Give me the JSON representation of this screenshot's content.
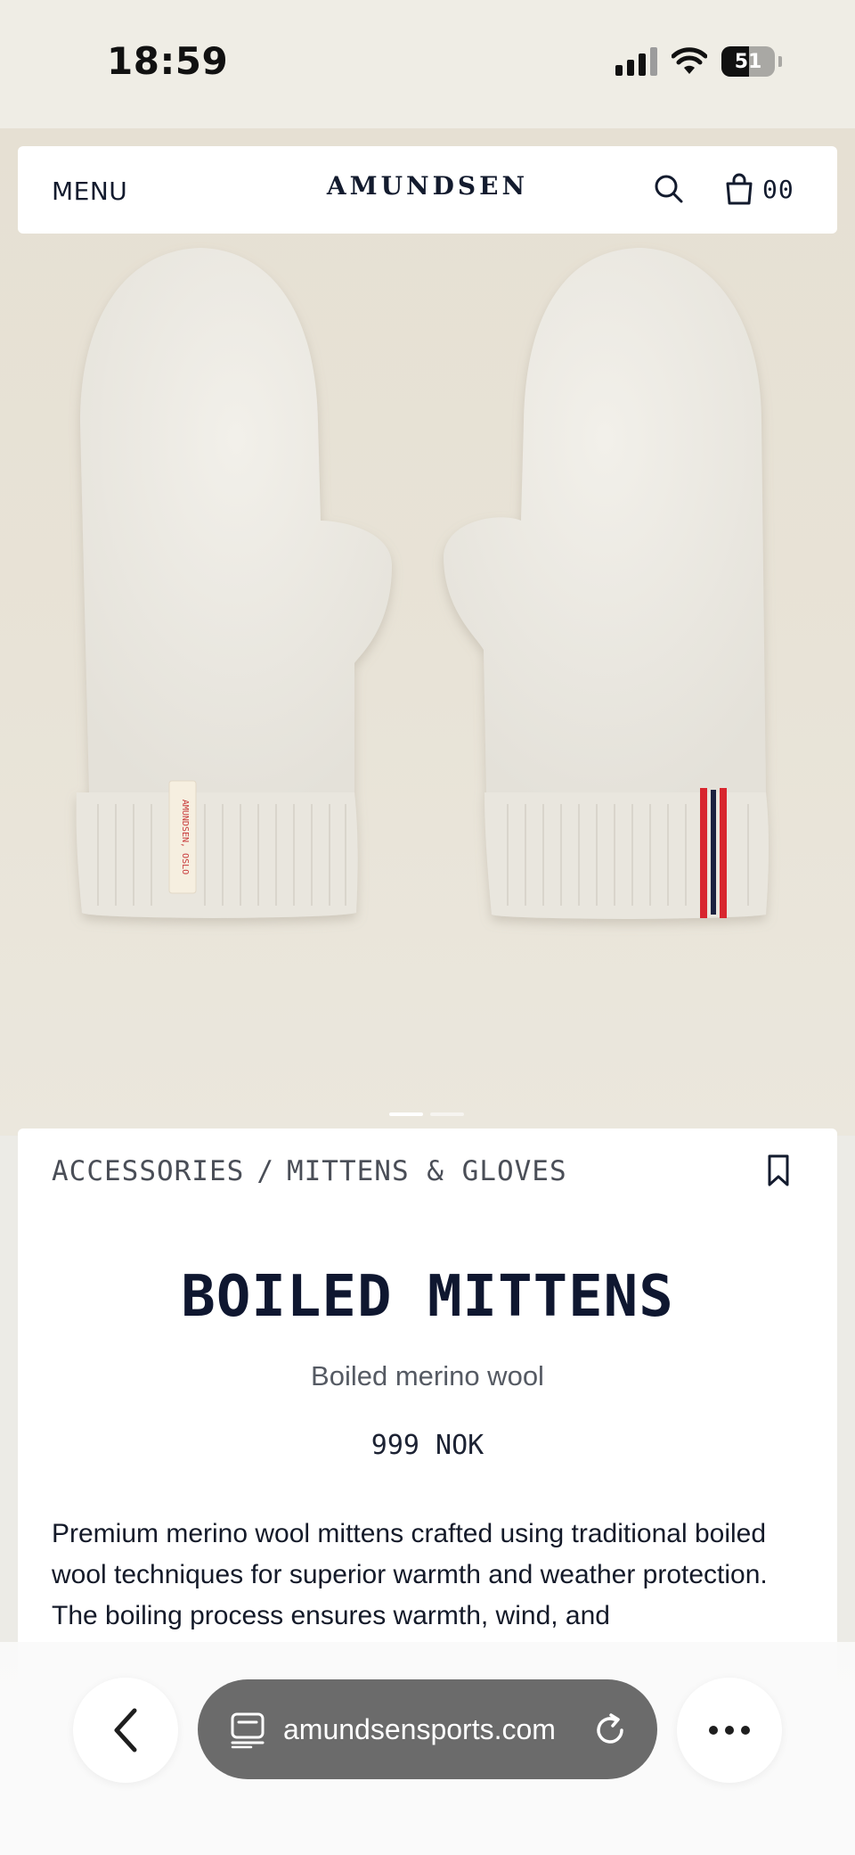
{
  "status_bar": {
    "time": "18:59",
    "battery_level": "51",
    "battery_fraction": 0.51
  },
  "header": {
    "menu_label": "MENU",
    "brand": "AMUNDSEN",
    "cart_count": "00",
    "icons": [
      "search-icon",
      "bag-icon"
    ]
  },
  "hero": {
    "image": "product-photo-white-mittens",
    "label_text": "AMUNDSEN, OSLO",
    "slides_total": 2,
    "active_slide": 1
  },
  "product": {
    "breadcrumb": [
      "ACCESSORIES",
      "MITTENS & GLOVES"
    ],
    "breadcrumb_separator": "/",
    "title": "BOILED MITTENS",
    "subtitle": "Boiled merino wool",
    "price": "999 NOK",
    "description": "Premium merino wool mittens crafted using traditional boiled wool techniques for superior warmth and weather protection. The boiling process ensures warmth, wind, and"
  },
  "browser": {
    "url": "amundsensports.com",
    "icons": [
      "chevron-left-icon",
      "tabs-icon",
      "reload-icon",
      "more-icon"
    ]
  },
  "colors": {
    "navy": "#0f1730",
    "stripe_red": "#d8272d",
    "stripe_navy": "#1a2040",
    "background": "#ecebe6"
  }
}
